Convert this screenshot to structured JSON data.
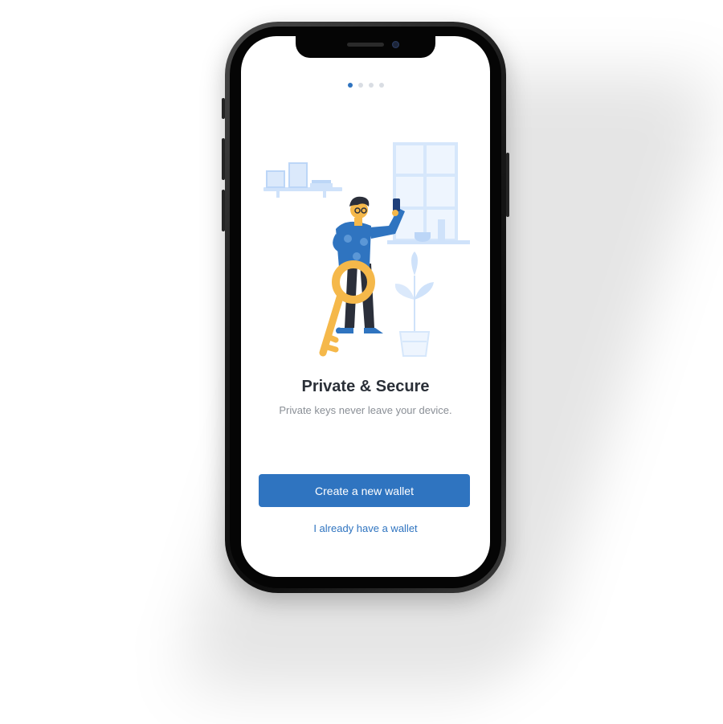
{
  "onboarding": {
    "page_dots": [
      {
        "active": true
      },
      {
        "active": false
      },
      {
        "active": false
      },
      {
        "active": false
      }
    ],
    "title": "Private & Secure",
    "subtitle": "Private keys never leave your device.",
    "primary_button_label": "Create a new wallet",
    "secondary_link_label": "I already have a wallet"
  },
  "colors": {
    "accent": "#2f74c0",
    "title_text": "#2b3038",
    "subtitle_text": "#8a8f96",
    "illustration_light_blue": "#dbe9fb",
    "key_yellow": "#f5b84a"
  },
  "icons": {
    "illustration": "person-holding-key-illustration"
  }
}
